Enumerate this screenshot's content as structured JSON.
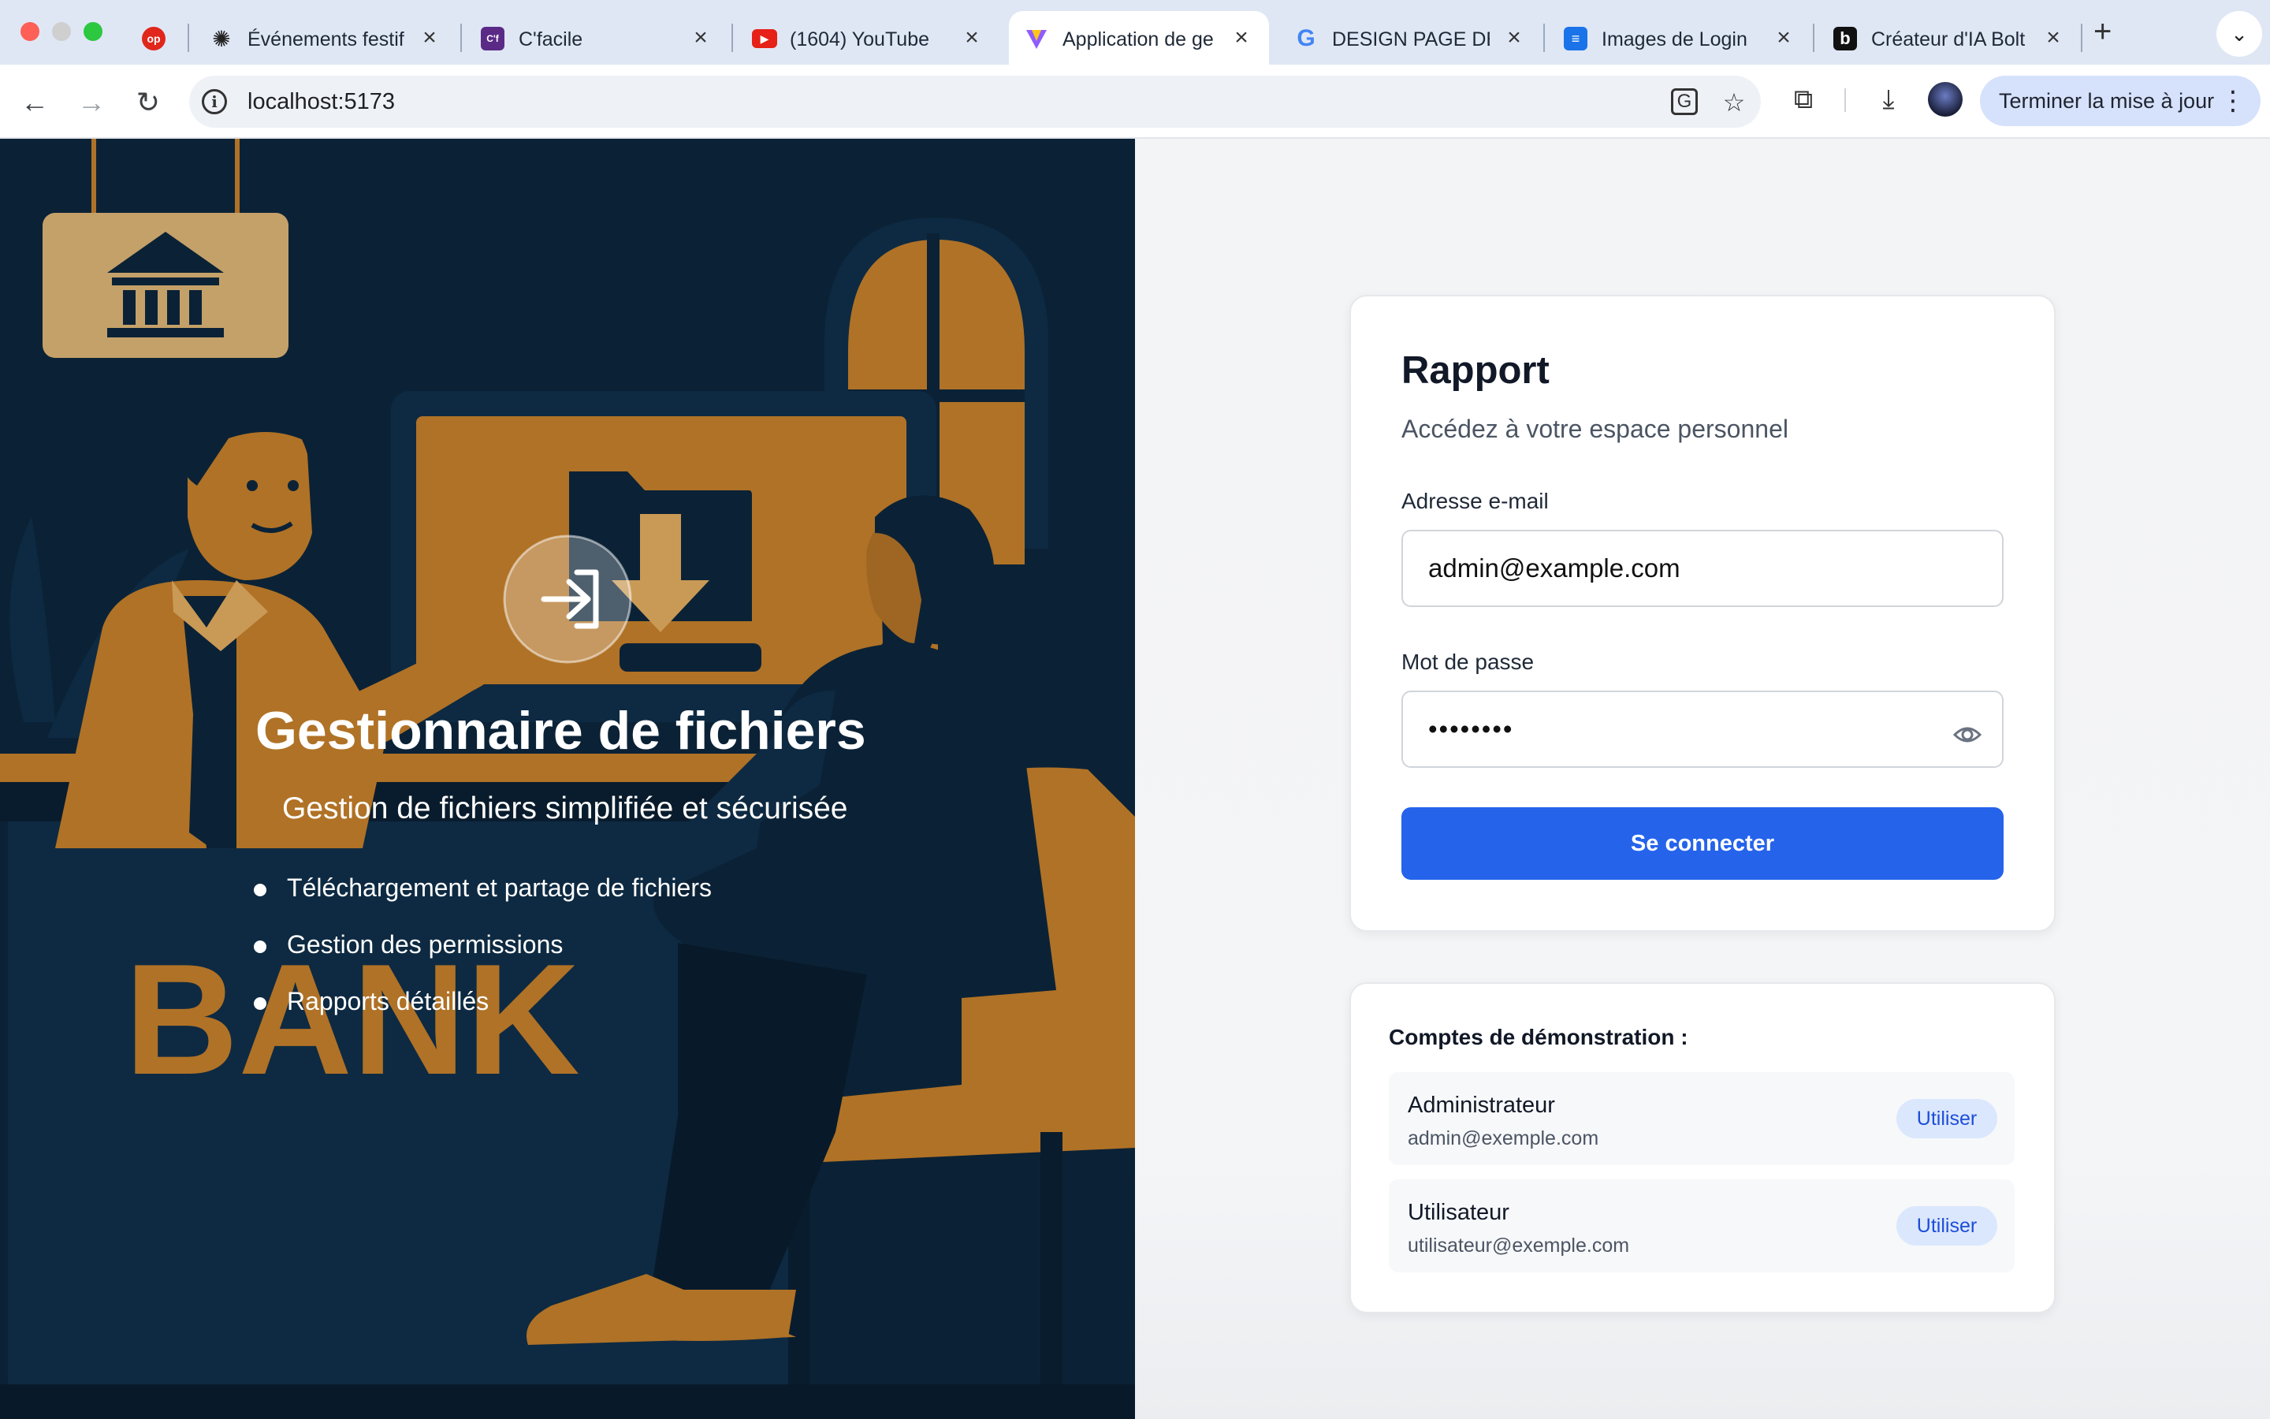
{
  "browser": {
    "tabs": [
      {
        "title": "",
        "icon": "app-icon",
        "color": "#e1261c"
      },
      {
        "title": "Événements festif",
        "icon": "openai-icon",
        "color": "#222222"
      },
      {
        "title": "C'facile",
        "icon": "cfacile-icon",
        "color": "#5b2a86"
      },
      {
        "title": "(1604) YouTube",
        "icon": "youtube-icon",
        "color": "#e62117"
      },
      {
        "title": "Application de ge",
        "icon": "vite-icon",
        "color": "#8f5cff"
      },
      {
        "title": "DESIGN PAGE DE",
        "icon": "google-icon",
        "color": "#4285f4"
      },
      {
        "title": "Images de Login",
        "icon": "forms-icon",
        "color": "#1a73e8"
      },
      {
        "title": "Créateur d'IA Bolt",
        "icon": "bolt-icon",
        "color": "#111111"
      }
    ],
    "url": "localhost:5173",
    "update_label": "Terminer la mise à jour"
  },
  "hero": {
    "title": "Gestionnaire de fichiers",
    "subtitle": "Gestion de fichiers simplifiée et sécurisée",
    "features": [
      "Téléchargement et partage de fichiers",
      "Gestion des permissions",
      "Rapports détaillés"
    ],
    "illustration_text": "BANK",
    "accent_color": "#b07226",
    "background_color": "#0b2236"
  },
  "login": {
    "title": "Rapport",
    "subtitle": "Accédez à votre espace personnel",
    "email_label": "Adresse e-mail",
    "email_value": "admin@example.com",
    "password_label": "Mot de passe",
    "password_value": "••••••••",
    "submit_label": "Se connecter",
    "primary_color": "#2563eb"
  },
  "demo": {
    "heading": "Comptes de démonstration :",
    "accounts": [
      {
        "role": "Administrateur",
        "email": "admin@exemple.com",
        "action": "Utiliser"
      },
      {
        "role": "Utilisateur",
        "email": "utilisateur@exemple.com",
        "action": "Utiliser"
      }
    ]
  }
}
